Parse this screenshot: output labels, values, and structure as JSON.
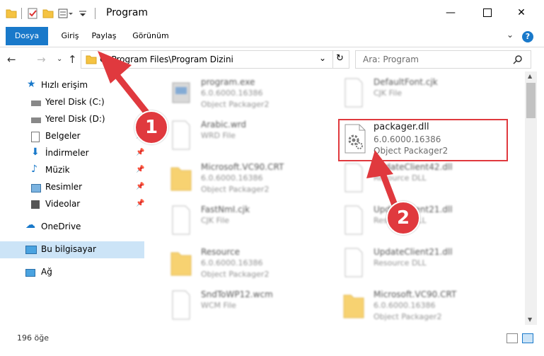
{
  "window": {
    "title": "Program"
  },
  "ribbon": {
    "tabs": [
      "Dosya",
      "Giriş",
      "Paylaş",
      "Görünüm"
    ]
  },
  "address": {
    "path": "C:\\Program Files\\Program Dizini"
  },
  "search": {
    "placeholder": "Ara: Program"
  },
  "sidebar": {
    "items": [
      {
        "label": "Hızlı erişim"
      },
      {
        "label": "Yerel Disk (C:)"
      },
      {
        "label": "Yerel Disk (D:)"
      },
      {
        "label": "Belgeler"
      },
      {
        "label": "İndirmeler"
      },
      {
        "label": "Müzik"
      },
      {
        "label": "Resimler"
      },
      {
        "label": "Videolar"
      },
      {
        "label": "OneDrive"
      },
      {
        "label": "Bu bilgisayar"
      },
      {
        "label": "Ağ"
      }
    ]
  },
  "files": {
    "left": [
      {
        "name": "program.exe",
        "line1": "6.0.6000.16386",
        "line2": "Object Packager2"
      },
      {
        "name": "Arabic.wrd",
        "line1": "WRD File",
        "line2": ""
      },
      {
        "name": "Microsoft.VC90.CRT",
        "line1": "6.0.6000.16386",
        "line2": "Object Packager2"
      },
      {
        "name": "FastNmI.cjk",
        "line1": "CJK File",
        "line2": ""
      },
      {
        "name": "Resource",
        "line1": "6.0.6000.16386",
        "line2": "Object Packager2"
      },
      {
        "name": "SndToWP12.wcm",
        "line1": "WCM File",
        "line2": ""
      }
    ],
    "right": [
      {
        "name": "DefaultFont.cjk",
        "line1": "CJK File",
        "line2": ""
      },
      {
        "name": "UpdateClient42.dll",
        "line1": "Resource DLL",
        "line2": ""
      },
      {
        "name": "UpdateClient21.dll",
        "line1": "Resource DLL",
        "line2": ""
      },
      {
        "name": "UpdateClient21.dll",
        "line1": "Resource DLL",
        "line2": ""
      },
      {
        "name": "Microsoft.VC90.CRT",
        "line1": "6.0.6000.16386",
        "line2": "Object Packager2"
      }
    ],
    "highlighted": {
      "name": "packager.dll",
      "line1": "6.0.6000.16386",
      "line2": "Object Packager2"
    }
  },
  "status": {
    "count": "196 öğe"
  },
  "annotations": {
    "step1": "1",
    "step2": "2",
    "color": "#e0393e"
  }
}
